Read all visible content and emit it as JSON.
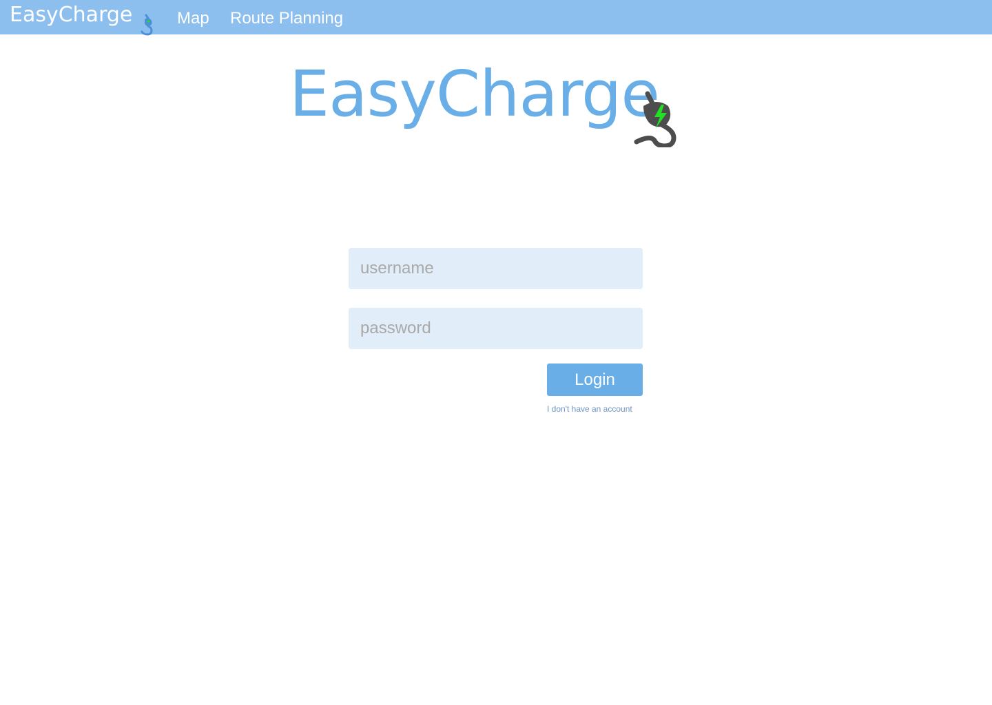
{
  "topbar": {
    "logo_text": "EasyCharge",
    "nav": [
      {
        "label": "Map"
      },
      {
        "label": "Route Planning"
      }
    ]
  },
  "hero": {
    "logo_text": "EasyCharge",
    "icon": "plug-icon"
  },
  "login_form": {
    "username_placeholder": "username",
    "password_placeholder": "password",
    "login_label": "Login",
    "no_account_link": "I don't have an account"
  },
  "colors": {
    "topbar_bg": "#8cbeee",
    "brand_blue": "#69aee7",
    "field_bg": "#e1edf8",
    "bolt_green": "#22e022",
    "plug_gray": "#4d4d4d"
  }
}
